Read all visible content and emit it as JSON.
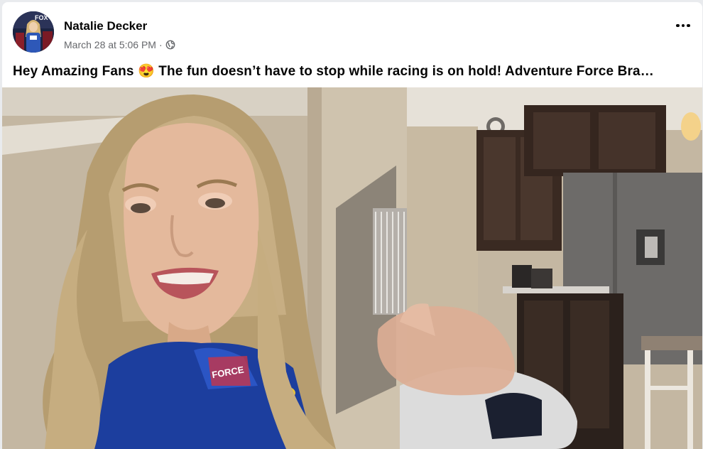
{
  "post": {
    "author": "Natalie Decker",
    "timestamp": "March 28 at 5:06 PM",
    "separator": "·",
    "audience_icon": "globe-icon",
    "more_icon": "more-options-icon",
    "text": "Hey Amazing Fans 😍 The fun doesn’t have to stop while racing is on hold! Adventure Force Bra…"
  },
  "avatar": {
    "badge_text": "FOX"
  },
  "video": {
    "suit_text": "FORCE"
  },
  "colors": {
    "author": "#050505",
    "meta": "#65676b",
    "background": "#ffffff"
  }
}
